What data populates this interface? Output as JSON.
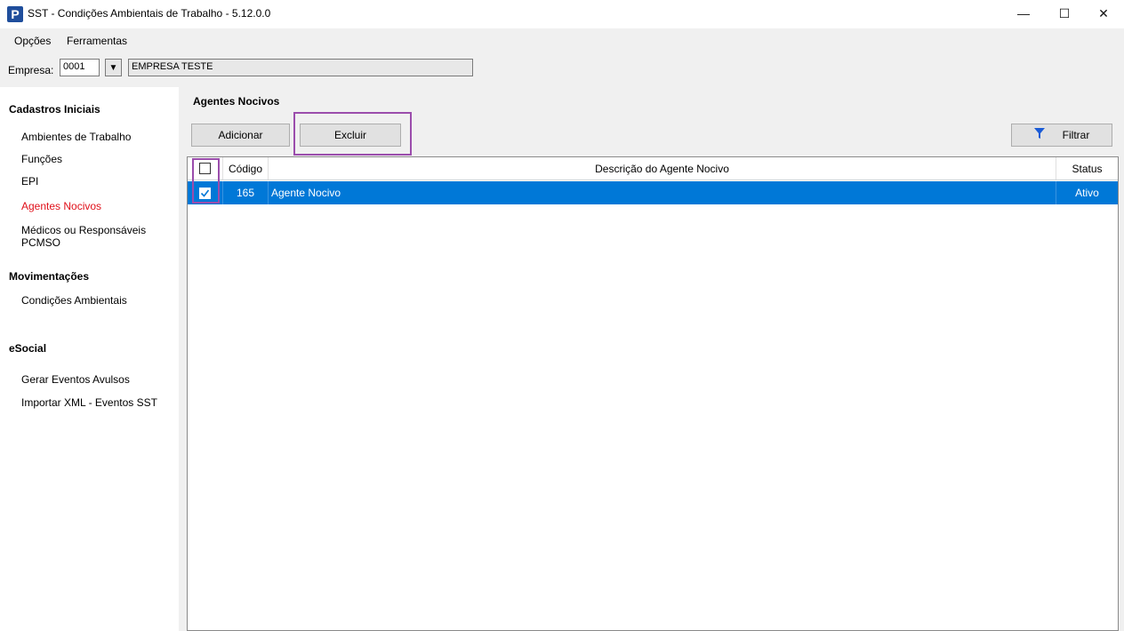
{
  "window": {
    "title": "SST - Condições Ambientais de Trabalho - 5.12.0.0",
    "icon_letter": "P",
    "minimize": "—",
    "maximize": "☐",
    "close": "✕"
  },
  "menu": {
    "items": [
      "Opções",
      "Ferramentas"
    ]
  },
  "empresa": {
    "label": "Empresa:",
    "code": "0001",
    "dropdown_glyph": "▼",
    "name": "EMPRESA TESTE"
  },
  "sidebar": {
    "sections": [
      {
        "title": "Cadastros Iniciais",
        "items": [
          "Ambientes de Trabalho",
          "Funções",
          "EPI",
          "Agentes Nocivos",
          "Médicos ou Responsáveis PCMSO"
        ]
      },
      {
        "title": "Movimentações",
        "items": [
          "Condições Ambientais"
        ]
      },
      {
        "title": "eSocial",
        "items": [
          "Gerar Eventos Avulsos",
          "Importar XML - Eventos SST"
        ]
      }
    ],
    "active_item": "Agentes Nocivos",
    "active_color": "#e0101a"
  },
  "main": {
    "title": "Agentes Nocivos",
    "buttons": {
      "add": "Adicionar",
      "delete": "Excluir",
      "filter": "Filtrar"
    },
    "highlight_color": "#9b4dac",
    "table": {
      "columns": [
        "",
        "Código",
        "Descrição do Agente Nocivo",
        "Status"
      ],
      "rows": [
        {
          "checked": true,
          "codigo": "165",
          "descricao": "Agente Nocivo",
          "status": "Ativo"
        }
      ],
      "header_checked": false,
      "selected_row_color": "#0078d7"
    }
  }
}
